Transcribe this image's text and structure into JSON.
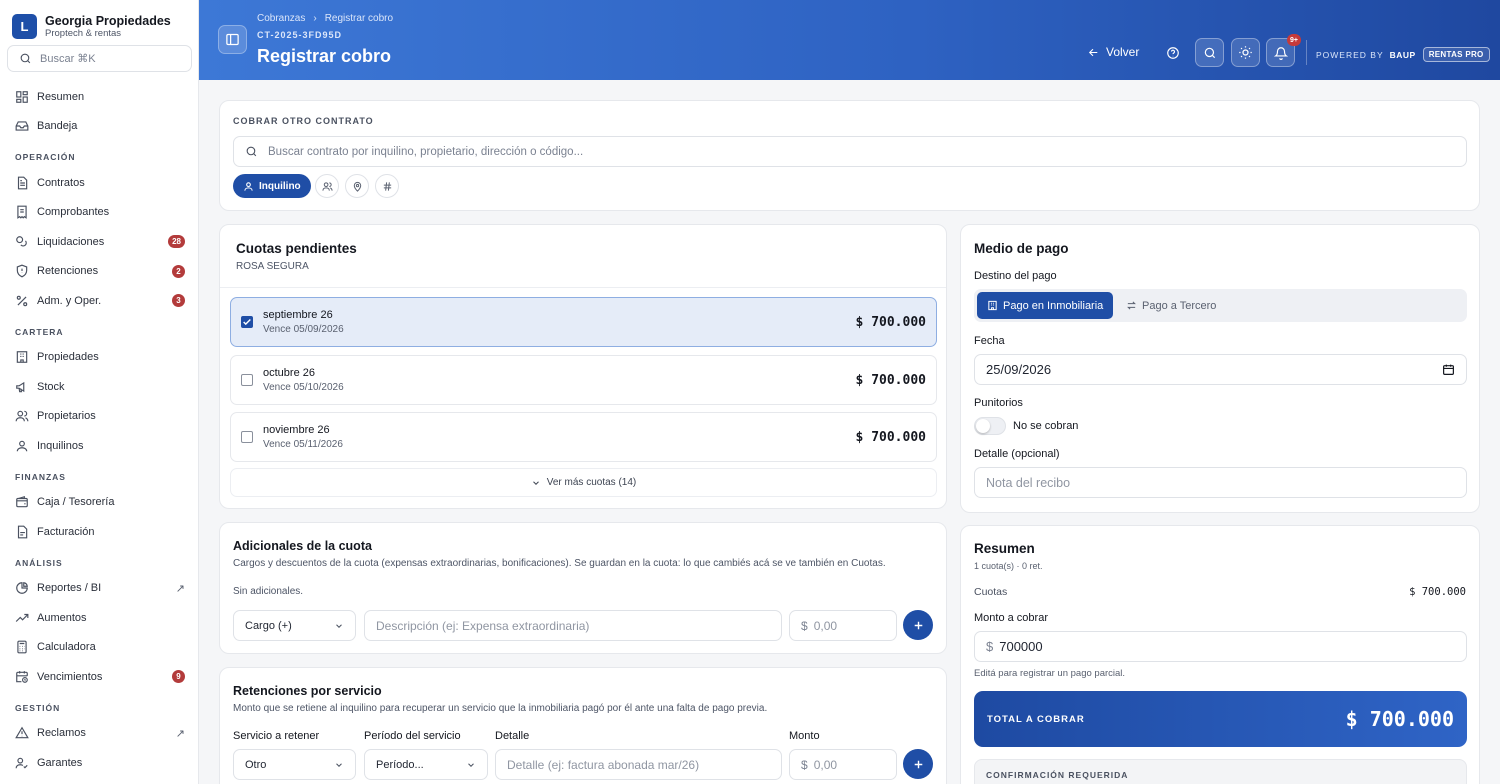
{
  "brand": {
    "logo_letter": "L",
    "name": "Georgia Propiedades",
    "subtitle": "Proptech & rentas"
  },
  "sidebar": {
    "search_placeholder": "Buscar ⌘K",
    "items": [
      {
        "label": "Resumen",
        "icon": "dashboard-icon"
      },
      {
        "label": "Bandeja",
        "icon": "inbox-icon"
      }
    ],
    "sections": [
      {
        "title": "OPERACIÓN",
        "items": [
          {
            "label": "Contratos",
            "icon": "document-icon"
          },
          {
            "label": "Comprobantes",
            "icon": "receipt-icon"
          },
          {
            "label": "Liquidaciones",
            "icon": "coins-icon",
            "badge": "28"
          },
          {
            "label": "Retenciones",
            "icon": "shield-icon",
            "badge": "2"
          },
          {
            "label": "Adm. y Oper.",
            "icon": "percent-icon",
            "badge": "3"
          }
        ]
      },
      {
        "title": "CARTERA",
        "items": [
          {
            "label": "Propiedades",
            "icon": "building-icon"
          },
          {
            "label": "Stock",
            "icon": "megaphone-icon"
          },
          {
            "label": "Propietarios",
            "icon": "users-icon"
          },
          {
            "label": "Inquilinos",
            "icon": "user-icon"
          }
        ]
      },
      {
        "title": "FINANZAS",
        "items": [
          {
            "label": "Caja / Tesorería",
            "icon": "wallet-icon"
          },
          {
            "label": "Facturación",
            "icon": "invoice-icon"
          }
        ]
      },
      {
        "title": "ANÁLISIS",
        "items": [
          {
            "label": "Reportes / BI",
            "icon": "chart-icon",
            "external": "↗"
          },
          {
            "label": "Aumentos",
            "icon": "trending-up-icon"
          },
          {
            "label": "Calculadora",
            "icon": "calculator-icon"
          },
          {
            "label": "Vencimientos",
            "icon": "calendar-clock-icon",
            "badge": "9"
          }
        ]
      },
      {
        "title": "GESTIÓN",
        "items": [
          {
            "label": "Reclamos",
            "icon": "alert-icon",
            "external": "↗"
          },
          {
            "label": "Garantes",
            "icon": "user-check-icon"
          }
        ]
      }
    ]
  },
  "header": {
    "breadcrumb": [
      "Cobranzas",
      "Registrar cobro"
    ],
    "breadcrumb_sep": "›",
    "code": "CT-2025-3FD95D",
    "title": "Registrar cobro",
    "back_label": "Volver",
    "notif_badge": "9+",
    "powered_by": "POWERED BY",
    "powered_brand": "BAUP",
    "plan": "RENTAS PRO"
  },
  "contract_search": {
    "label": "COBRAR OTRO CONTRATO",
    "placeholder": "Buscar contrato por inquilino, propietario, dirección o código...",
    "active_filter": "Inquilino"
  },
  "cuotas": {
    "title": "Cuotas pendientes",
    "tenant": "ROSA SEGURA",
    "items": [
      {
        "name": "septiembre 26",
        "due": "Vence 05/09/2026",
        "amount": "$ 700.000",
        "selected": true
      },
      {
        "name": "octubre 26",
        "due": "Vence 05/10/2026",
        "amount": "$ 700.000",
        "selected": false
      },
      {
        "name": "noviembre 26",
        "due": "Vence 05/11/2026",
        "amount": "$ 700.000",
        "selected": false
      }
    ],
    "more_label": "Ver más cuotas (14)"
  },
  "adicionales": {
    "title": "Adicionales de la cuota",
    "description": "Cargos y descuentos de la cuota (expensas extraordinarias, bonificaciones). Se guardan en la cuota: lo que cambiés acá se ve también en Cuotas.",
    "empty": "Sin adicionales.",
    "type_value": "Cargo (+)",
    "desc_placeholder": "Descripción (ej: Expensa extraordinaria)",
    "currency": "$",
    "amount_placeholder": "0,00"
  },
  "retenciones": {
    "title": "Retenciones por servicio",
    "description": "Monto que se retiene al inquilino para recuperar un servicio que la inmobiliaria pagó por él ante una falta de pago previa.",
    "col_servicio": "Servicio a retener",
    "col_periodo": "Período del servicio",
    "col_detalle": "Detalle",
    "col_monto": "Monto",
    "servicio_value": "Otro",
    "periodo_value": "Período...",
    "detalle_placeholder": "Detalle (ej: factura abonada mar/26)",
    "currency": "$",
    "monto_placeholder": "0,00"
  },
  "medio_pago": {
    "title": "Medio de pago",
    "destino_label": "Destino del pago",
    "option_active": "Pago en Inmobiliaria",
    "option_other": "Pago a Tercero",
    "fecha_label": "Fecha",
    "fecha_value": "25/09/2026",
    "punitorios_label": "Punitorios",
    "punitorios_value": "No se cobran",
    "detalle_label": "Detalle (opcional)",
    "detalle_placeholder": "Nota del recibo"
  },
  "resumen": {
    "title": "Resumen",
    "sub": "1 cuota(s) · 0 ret.",
    "cuotas_label": "Cuotas",
    "cuotas_value": "$ 700.000",
    "monto_label": "Monto a cobrar",
    "currency": "$",
    "monto_value": "700000",
    "hint": "Editá para registrar un pago parcial.",
    "total_label": "TOTAL A COBRAR",
    "total_value": "$ 700.000",
    "confirm_label": "CONFIRMACIÓN REQUERIDA"
  },
  "colors": {
    "accent": "#1f4ea6",
    "header_start": "#3d78d6",
    "header_end": "#1f48a0",
    "badge": "#b33b3b"
  }
}
